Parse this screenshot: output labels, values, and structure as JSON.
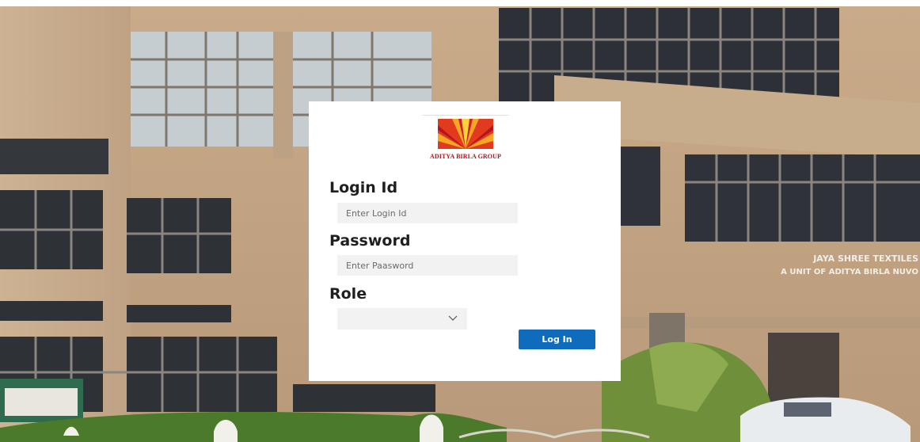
{
  "brand": {
    "name": "ADITYA BIRLA GROUP",
    "logo_color_primary": "#c8102e",
    "logo_color_secondary": "#f5a623"
  },
  "background": {
    "sign_line1": "JAYA SHREE TEXTILES",
    "sign_line2": "A UNIT OF ADITYA BIRLA NUVO"
  },
  "form": {
    "login_id_label": "Login Id",
    "login_id_placeholder": "Enter Login Id",
    "login_id_value": "",
    "password_label": "Password",
    "password_placeholder": "Enter Paasword",
    "password_value": "",
    "role_label": "Role",
    "role_value": "",
    "submit_label": "Log In"
  },
  "colors": {
    "button_bg": "#0f6cbd",
    "input_bg": "#f2f2f2"
  }
}
